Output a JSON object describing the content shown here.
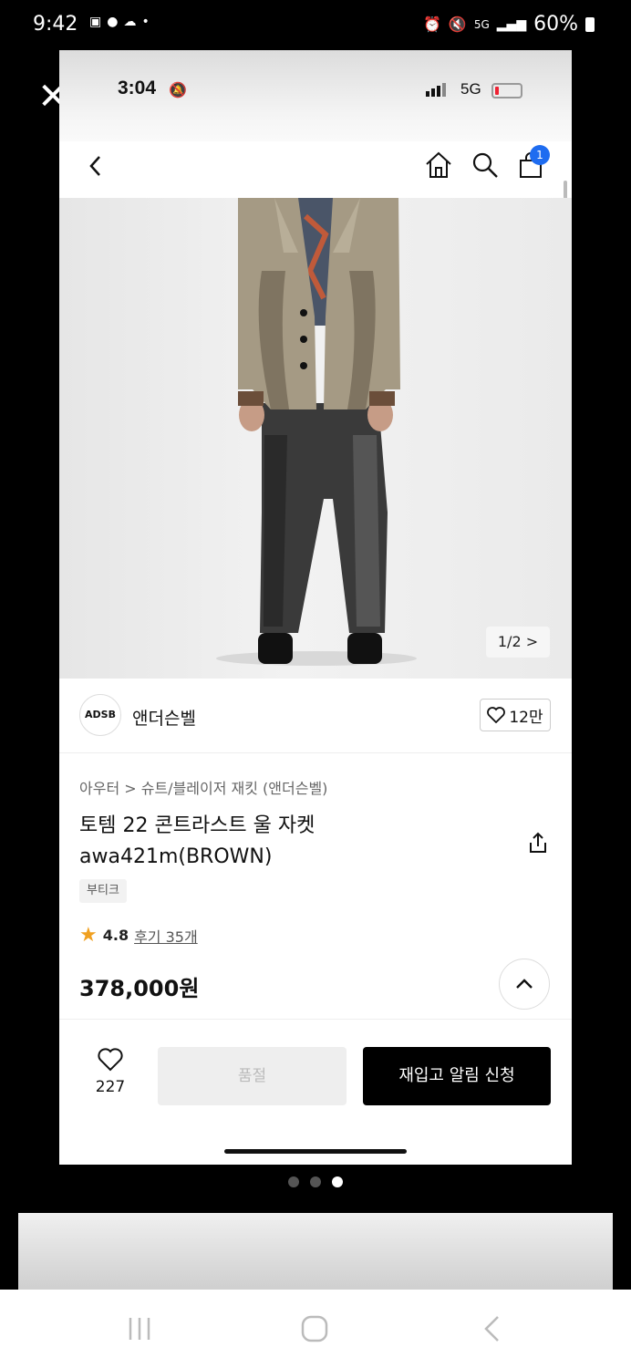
{
  "outer_status": {
    "time": "9:42",
    "battery": "60%",
    "network": "5G"
  },
  "inner_status": {
    "time": "3:04",
    "network": "5G"
  },
  "nav": {
    "cart_count": "1"
  },
  "image_counter": "1/2 >",
  "brand": {
    "logo_text": "ADSB",
    "name": "앤더슨벨",
    "like_count": "12만"
  },
  "product": {
    "breadcrumb": "아우터 > 슈트/블레이저 재킷 (앤더슨벨)",
    "title": "토템 22 콘트라스트 울 자켓 awa421m(BROWN)",
    "tag": "부티크",
    "rating": "4.8",
    "review_link": "후기 35개",
    "price": "378,000원"
  },
  "bottom": {
    "wish_count": "227",
    "soldout_label": "품절",
    "restock_label": "재입고 알림 신청"
  },
  "colors": {
    "accent_badge": "#1e6cf0",
    "cta_bg": "#000000",
    "star": "#f0a020"
  }
}
